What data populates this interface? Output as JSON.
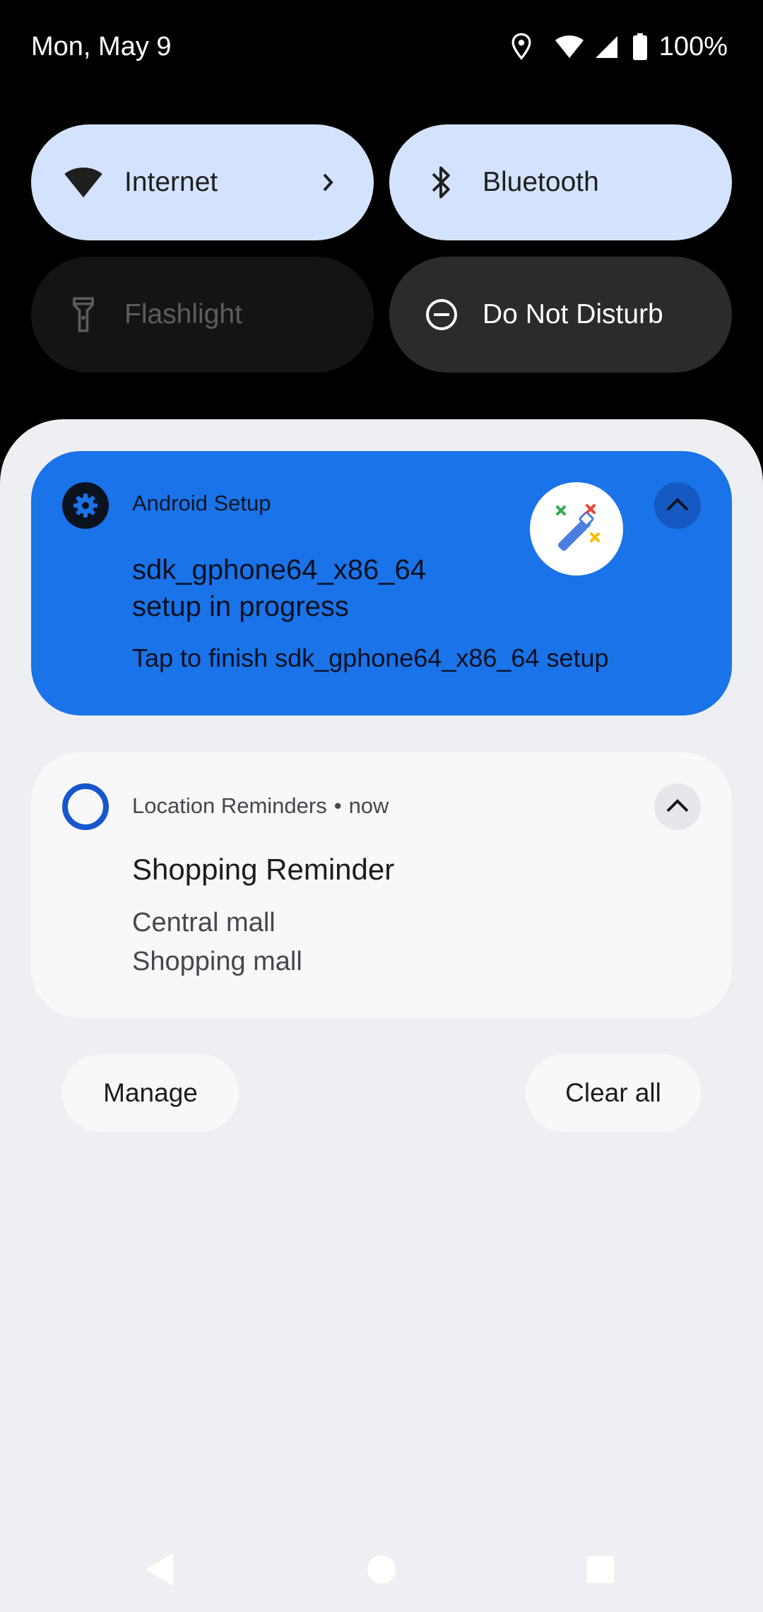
{
  "status_bar": {
    "date": "Mon, May 9",
    "battery": "100%",
    "icons": [
      "location-icon",
      "wifi-icon",
      "cellular-signal-icon",
      "battery-icon"
    ]
  },
  "quick_settings": {
    "tiles": [
      {
        "label": "Internet",
        "icon": "wifi-icon",
        "state": "on"
      },
      {
        "label": "Bluetooth",
        "icon": "bluetooth-icon",
        "state": "on"
      },
      {
        "label": "Flashlight",
        "icon": "flashlight-icon",
        "state": "unavailable"
      },
      {
        "label": "Do Not Disturb",
        "icon": "do-not-disturb-icon",
        "state": "off"
      }
    ]
  },
  "notifications": {
    "setup": {
      "app_name": "Android Setup",
      "title": "sdk_gphone64_x86_64 setup in progress",
      "text": "Tap to finish sdk_gphone64_x86_64 setup",
      "background": "#1a73e8"
    },
    "reminder": {
      "app_name": "Location Reminders",
      "separator": "•",
      "time": "now",
      "title": "Shopping Reminder",
      "line1": "Central mall",
      "line2": "Shopping mall"
    }
  },
  "footer": {
    "manage_label": "Manage",
    "clear_all_label": "Clear all"
  },
  "nav_bar": {
    "icons": [
      "back-icon",
      "home-icon",
      "recents-icon"
    ]
  }
}
